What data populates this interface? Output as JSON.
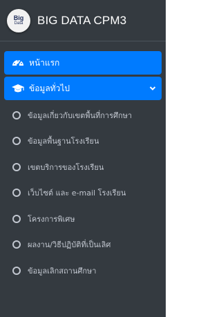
{
  "brand": {
    "logo_top": "Big",
    "logo_bottom": "Data",
    "title": "BIG DATA CPM3"
  },
  "nav": {
    "home": {
      "label": "หน้าแรก",
      "icon": "dashboard-icon"
    },
    "general": {
      "label": "ข้อมูลทั่วไป",
      "icon": "graduation-cap-icon",
      "expanded": true
    }
  },
  "submenu": [
    {
      "label": "ข้อมูลเกี่ยวกับเขตพื้นที่การศึกษา"
    },
    {
      "label": "ข้อมูลพื้นฐานโรงเรียน"
    },
    {
      "label": "เขตบริการของโรงเรียน"
    },
    {
      "label": "เว็บไซต์ และ e-mail โรงเรียน"
    },
    {
      "label": "โครงการพิเศษ"
    },
    {
      "label": "ผลงาน/วิธีปฏิบัติที่เป็นเลิศ"
    },
    {
      "label": "ข้อมูลเลิกสถานศึกษา"
    }
  ],
  "colors": {
    "sidebar_bg": "#343a40",
    "active": "#007bff",
    "text": "#c2c7d0"
  }
}
